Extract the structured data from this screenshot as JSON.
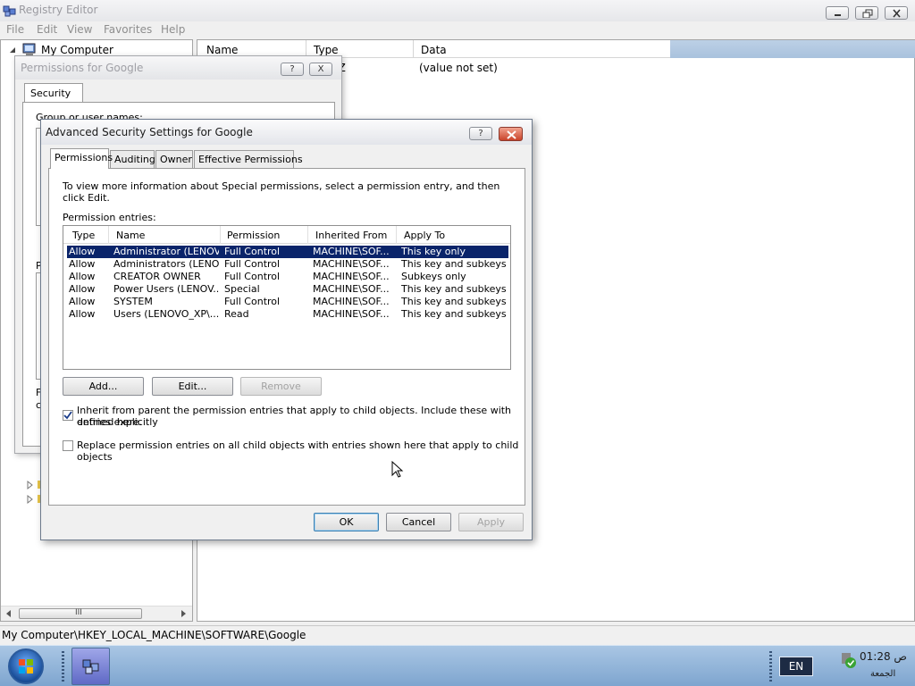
{
  "registry": {
    "title": "Registry Editor",
    "menu": [
      "File",
      "Edit",
      "View",
      "Favorites",
      "Help"
    ],
    "tree_root": "My Computer",
    "columns": [
      "Name",
      "Type",
      "Data"
    ],
    "row": {
      "type_fragment": "SZ",
      "data": "(value not set)"
    },
    "status_path": "My Computer\\HKEY_LOCAL_MACHINE\\SOFTWARE\\Google",
    "scroll_thumb_glyph": "III"
  },
  "permissions_dialog": {
    "title": "Permissions for Google",
    "help_label": "?",
    "close_label": "X",
    "tab": "Security",
    "group_text": "Group or user names:",
    "side_letters": [
      "P",
      "F",
      "c"
    ]
  },
  "advanced_dialog": {
    "title": "Advanced Security Settings for Google",
    "help_label": "?",
    "tabs": [
      "Permissions",
      "Auditing",
      "Owner",
      "Effective Permissions"
    ],
    "info_text": "To view more information about Special permissions, select a permission entry, and then click Edit.",
    "entries_label": "Permission entries:",
    "columns": [
      "Type",
      "Name",
      "Permission",
      "Inherited From",
      "Apply To"
    ],
    "entries": [
      {
        "type": "Allow",
        "name": "Administrator (LENOV...",
        "permission": "Full Control",
        "inherited": "MACHINE\\SOF...",
        "apply_to": "This key only"
      },
      {
        "type": "Allow",
        "name": "Administrators (LENO...",
        "permission": "Full Control",
        "inherited": "MACHINE\\SOF...",
        "apply_to": "This key and subkeys"
      },
      {
        "type": "Allow",
        "name": "CREATOR OWNER",
        "permission": "Full Control",
        "inherited": "MACHINE\\SOF...",
        "apply_to": "Subkeys only"
      },
      {
        "type": "Allow",
        "name": "Power Users (LENOV...",
        "permission": "Special",
        "inherited": "MACHINE\\SOF...",
        "apply_to": "This key and subkeys"
      },
      {
        "type": "Allow",
        "name": "SYSTEM",
        "permission": "Full Control",
        "inherited": "MACHINE\\SOF...",
        "apply_to": "This key and subkeys"
      },
      {
        "type": "Allow",
        "name": "Users (LENOVO_XP\\...",
        "permission": "Read",
        "inherited": "MACHINE\\SOF...",
        "apply_to": "This key and subkeys"
      }
    ],
    "buttons": {
      "add": "Add...",
      "edit": "Edit...",
      "remove": "Remove"
    },
    "inherit_checkbox": {
      "checked": true,
      "line1": "Inherit from parent the permission entries that apply to child objects. Include these with entries explicitly",
      "line2": "defined here."
    },
    "replace_checkbox": {
      "checked": false,
      "label": "Replace permission entries on all child objects with entries shown here that apply to child objects"
    },
    "footer": {
      "ok": "OK",
      "cancel": "Cancel",
      "apply": "Apply"
    }
  },
  "taskbar": {
    "language": "EN",
    "time": "01:28 ص",
    "day": "الجمعة"
  },
  "colors": {
    "selection": "#0a246a",
    "taskbar": "#9dbbe0"
  }
}
